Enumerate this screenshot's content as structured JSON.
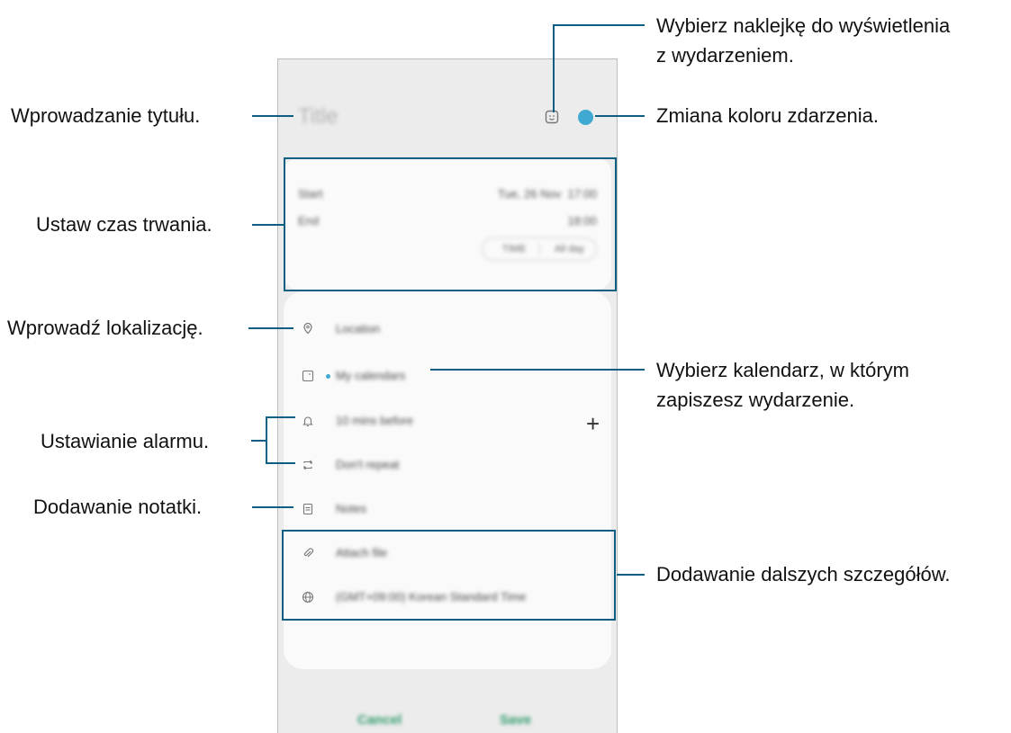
{
  "annotations": {
    "sticker_line1": "Wybierz naklejkę do wyświetlenia",
    "sticker_line2": "z wydarzeniem.",
    "title": "Wprowadzanie tytułu.",
    "color": "Zmiana koloru zdarzenia.",
    "duration": "Ustaw czas trwania.",
    "location": "Wprowadź lokalizację.",
    "calendar_line1": "Wybierz kalendarz, w którym",
    "calendar_line2": "zapiszesz wydarzenie.",
    "alarm": "Ustawianie alarmu.",
    "notes": "Dodawanie notatki.",
    "more": "Dodawanie dalszych szczegółów."
  },
  "event": {
    "title_placeholder": "Title",
    "color": "#3fa9d2",
    "start_label": "Start",
    "start_date": "Tue, 26 Nov",
    "start_time": "17:00",
    "end_label": "End",
    "end_time": "18:00",
    "time_toggle": "TIME",
    "allday_toggle": "All day",
    "location_placeholder": "Location",
    "calendar": "My calendars",
    "reminder": "10 mins before",
    "repeat": "Don't repeat",
    "notes_placeholder": "Notes",
    "attach": "Attach file",
    "timezone": "(GMT+09:00) Korean Standard Time",
    "cancel": "Cancel",
    "save": "Save"
  }
}
